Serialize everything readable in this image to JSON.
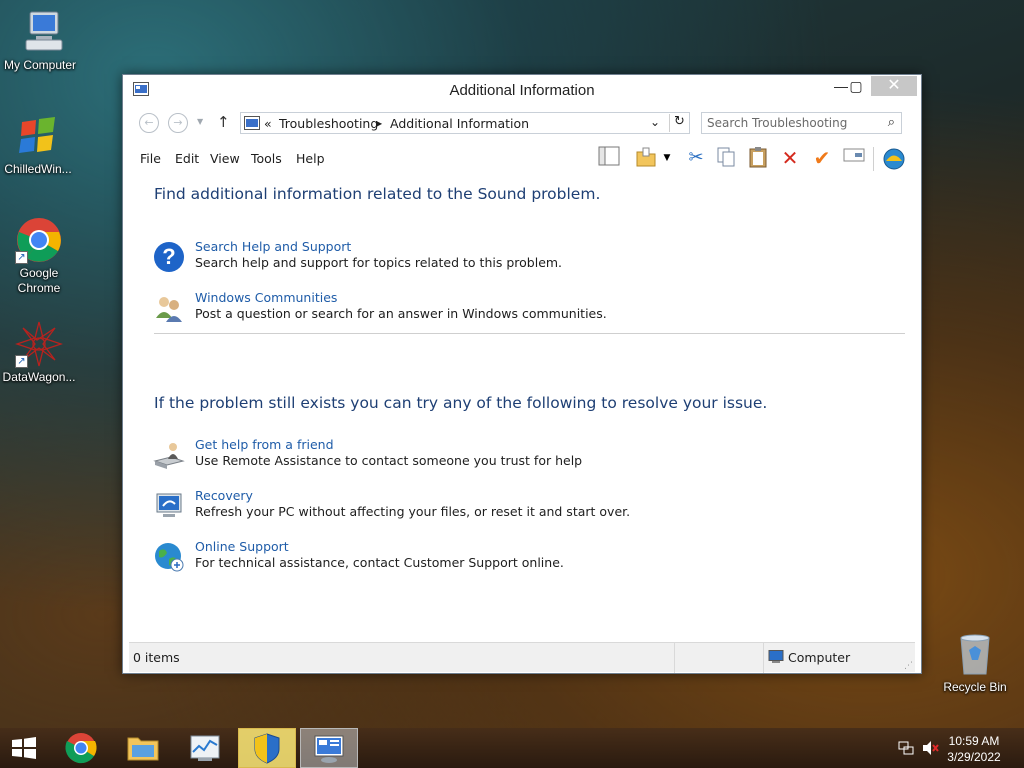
{
  "desktop": {
    "icons": [
      {
        "label": "My Computer"
      },
      {
        "label": "ChilledWin..."
      },
      {
        "label": "Google\nChrome"
      },
      {
        "label": "DataWagon..."
      },
      {
        "label": "Recycle Bin"
      }
    ]
  },
  "window": {
    "title": "Additional Information",
    "breadcrumb": {
      "overflow": "«",
      "items": [
        "Troubleshooting",
        "Additional Information"
      ]
    },
    "search_placeholder": "Search Troubleshooting",
    "menu": [
      "File",
      "Edit",
      "View",
      "Tools",
      "Help"
    ],
    "section1": {
      "heading": "Find additional information related to the Sound problem.",
      "tasks": [
        {
          "title": "Search Help and Support",
          "desc": "Search help and support for topics related to this problem.",
          "icon": "help-icon"
        },
        {
          "title": "Windows Communities",
          "desc": "Post a question or search for an answer in Windows communities.",
          "icon": "people-icon"
        }
      ]
    },
    "section2": {
      "heading": "If the problem still exists you can try any of the following to resolve your issue.",
      "tasks": [
        {
          "title": "Get help from a friend",
          "desc": "Use Remote Assistance to contact someone you trust for help",
          "icon": "remote-assistance-icon"
        },
        {
          "title": "Recovery",
          "desc": "Refresh your PC without affecting your files, or reset it and start over.",
          "icon": "recovery-icon"
        },
        {
          "title": "Online Support",
          "desc": "For technical assistance, contact Customer Support online.",
          "icon": "globe-icon"
        }
      ]
    },
    "status": {
      "items": "0 items",
      "location": "Computer"
    }
  },
  "taskbar": {
    "time": "10:59 AM",
    "date": "3/29/2022"
  },
  "colors": {
    "link": "#1f5ca8",
    "heading": "#1e3f74"
  }
}
